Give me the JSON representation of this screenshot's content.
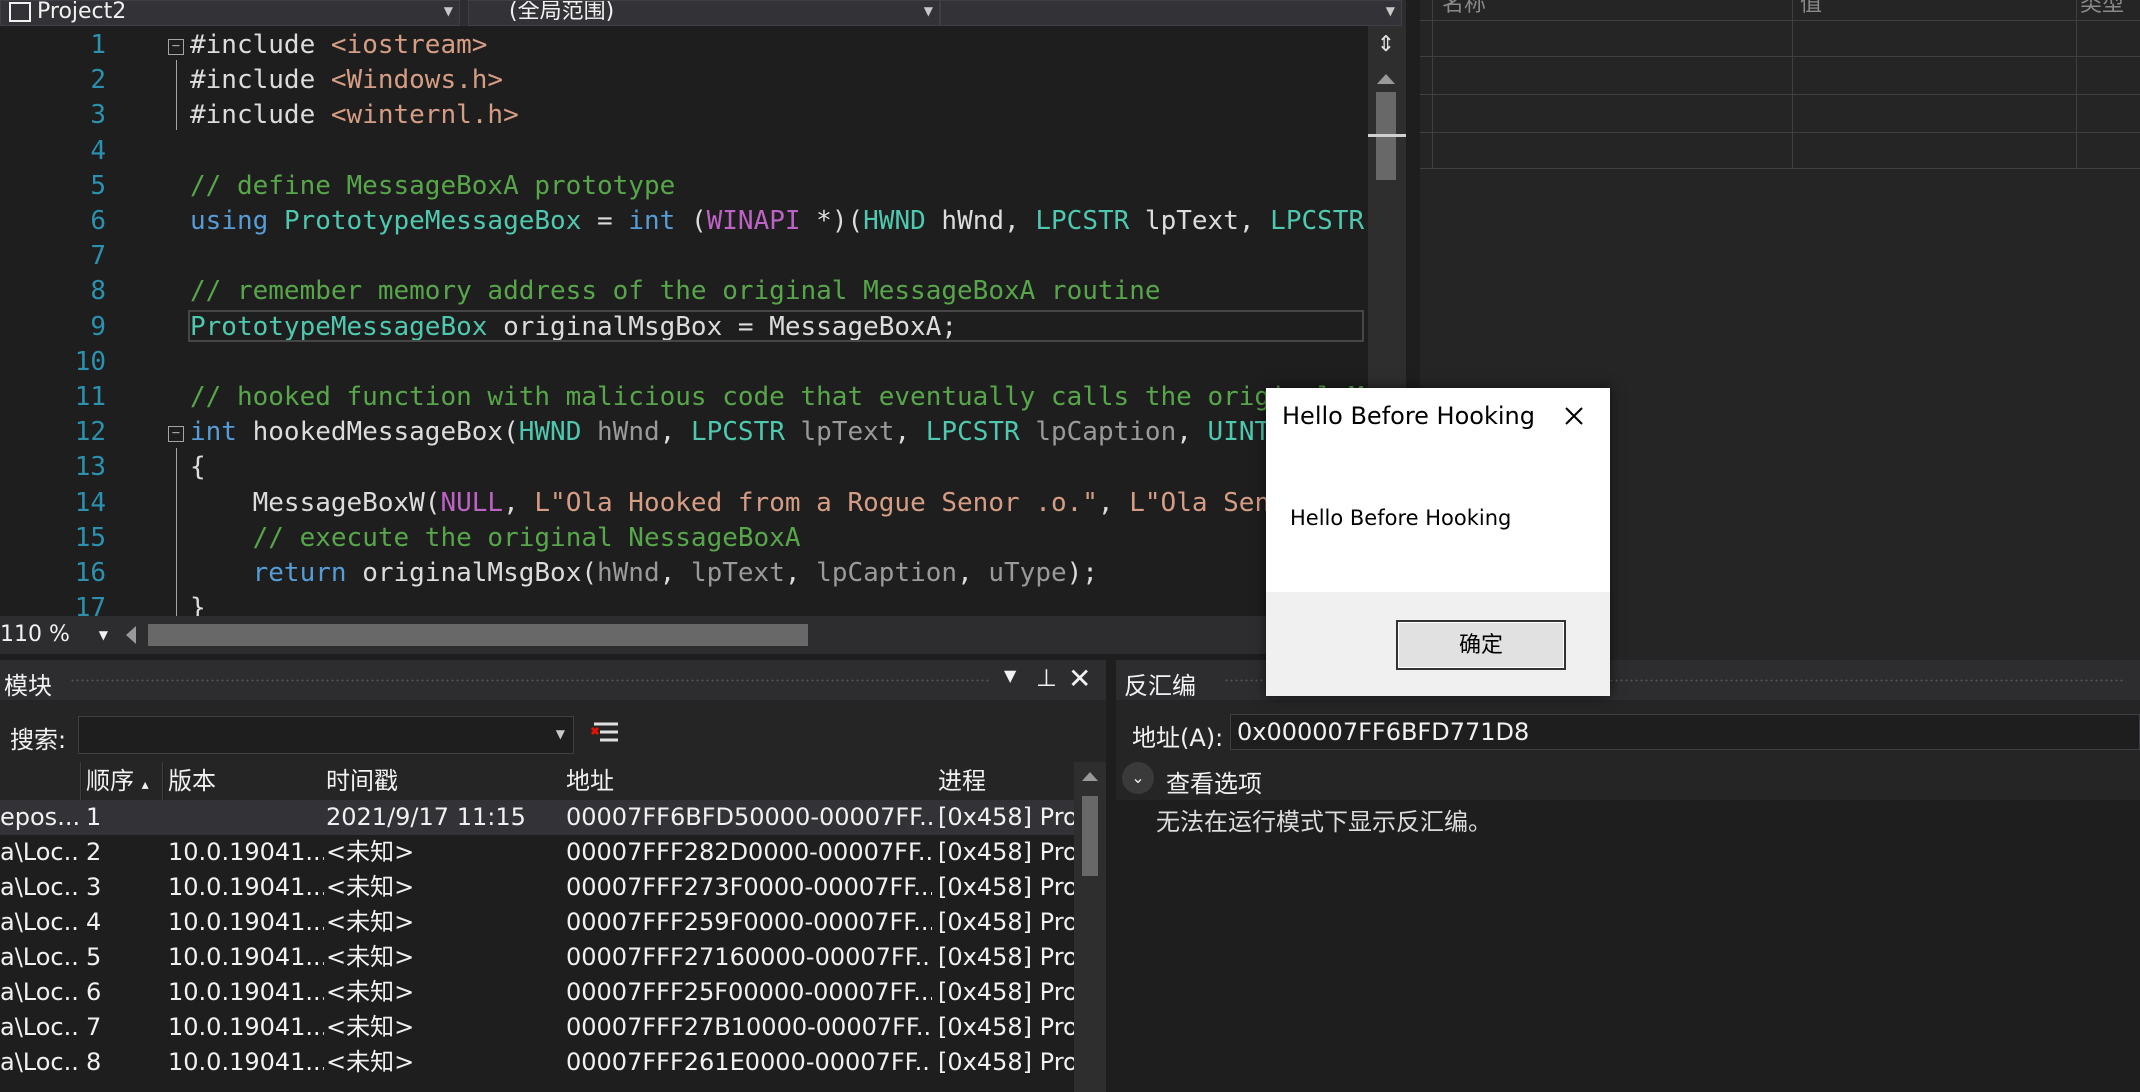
{
  "nav": {
    "project": "Project2",
    "scope": "(全局范围)"
  },
  "editor": {
    "lines": [
      {
        "n": "1",
        "html": "#include <span class=\"inc\">&lt;iostream&gt;</span>"
      },
      {
        "n": "2",
        "html": "#include <span class=\"inc\">&lt;Windows.h&gt;</span>"
      },
      {
        "n": "3",
        "html": "#include <span class=\"inc\">&lt;winternl.h&gt;</span>"
      },
      {
        "n": "4",
        "html": ""
      },
      {
        "n": "5",
        "html": "<span class=\"cm\">// define MessageBoxA prototype</span>"
      },
      {
        "n": "6",
        "html": "<span class=\"kw\">using</span> <span class=\"ty\">PrototypeMessageBox</span> = <span class=\"kw\">int</span> (<span class=\"mc\">WINAPI</span> *)(<span class=\"ty\">HWND</span> hWnd, <span class=\"ty\">LPCSTR</span> lpText, <span class=\"ty\">LPCSTR</span> lpCapti"
      },
      {
        "n": "7",
        "html": ""
      },
      {
        "n": "8",
        "html": "<span class=\"cm\">// remember memory address of the original MessageBoxA routine</span>"
      },
      {
        "n": "9",
        "html": "<span class=\"ty\">PrototypeMessageBox</span> originalMsgBox = MessageBoxA;"
      },
      {
        "n": "10",
        "html": ""
      },
      {
        "n": "11",
        "html": "<span class=\"cm\">// hooked function with malicious code that eventually calls the original M</span>"
      },
      {
        "n": "12",
        "html": "<span class=\"kw\">int</span> hookedMessageBox(<span class=\"ty\">HWND</span> <span class=\"pa\">hWnd</span>, <span class=\"ty\">LPCSTR</span> <span class=\"pa\">lpText</span>, <span class=\"ty\">LPCSTR</span> <span class=\"pa\">lpCaption</span>, <span class=\"ty\">UINT</span> <span class=\"pa\">uType</span>"
      },
      {
        "n": "13",
        "html": "{"
      },
      {
        "n": "14",
        "html": "    MessageBoxW(<span class=\"mc\">NULL</span>, <span class=\"st\">L\"Ola Hooked from a Rogue Senor .o.\"</span>, <span class=\"st\">L\"Ola Senor o/\"</span>"
      },
      {
        "n": "15",
        "html": "    <span class=\"cm\">// execute the original NessageBoxA</span>"
      },
      {
        "n": "16",
        "html": "    <span class=\"kw\">return</span> originalMsgBox(<span class=\"pa\">hWnd</span>, <span class=\"pa\">lpText</span>, <span class=\"pa\">lpCaption</span>, <span class=\"pa\">uType</span>);"
      },
      {
        "n": "17",
        "html": "}"
      }
    ]
  },
  "zoom": "110 %",
  "watch": {
    "col_name": "名称",
    "col_value": "值",
    "col_type": "类型"
  },
  "modules": {
    "title": "模块",
    "search_label": "搜索:",
    "search_value": "",
    "headers": [
      "",
      "顺序",
      "版本",
      "时间戳",
      "地址",
      "进程"
    ],
    "rows": [
      [
        "epos...",
        "1",
        "",
        "2021/9/17 11:15",
        "00007FF6BFD50000-00007FF...",
        "[0x458] Pro"
      ],
      [
        "a\\Loc...",
        "2",
        "10.0.19041....",
        "<未知>",
        "00007FFF282D0000-00007FF...",
        "[0x458] Pro"
      ],
      [
        "a\\Loc...",
        "3",
        "10.0.19041....",
        "<未知>",
        "00007FFF273F0000-00007FF...",
        "[0x458] Pro"
      ],
      [
        "a\\Loc...",
        "4",
        "10.0.19041....",
        "<未知>",
        "00007FFF259F0000-00007FF...",
        "[0x458] Pro"
      ],
      [
        "a\\Loc...",
        "5",
        "10.0.19041....",
        "<未知>",
        "00007FFF27160000-00007FF...",
        "[0x458] Pro"
      ],
      [
        "a\\Loc...",
        "6",
        "10.0.19041....",
        "<未知>",
        "00007FFF25F00000-00007FF...",
        "[0x458] Pro"
      ],
      [
        "a\\Loc...",
        "7",
        "10.0.19041....",
        "<未知>",
        "00007FFF27B10000-00007FF...",
        "[0x458] Pro"
      ],
      [
        "a\\Loc...",
        "8",
        "10.0.19041....",
        "<未知>",
        "00007FFF261E0000-00007FF...",
        "[0x458] Pro"
      ]
    ]
  },
  "disasm": {
    "title": "反汇编",
    "address_label": "地址(A):",
    "address_value": "0x000007FF6BFD771D8",
    "options_label": "查看选项",
    "message": "无法在运行模式下显示反汇编。"
  },
  "dialog": {
    "title": "Hello Before Hooking",
    "message": "Hello Before Hooking",
    "ok_label": "确定"
  }
}
